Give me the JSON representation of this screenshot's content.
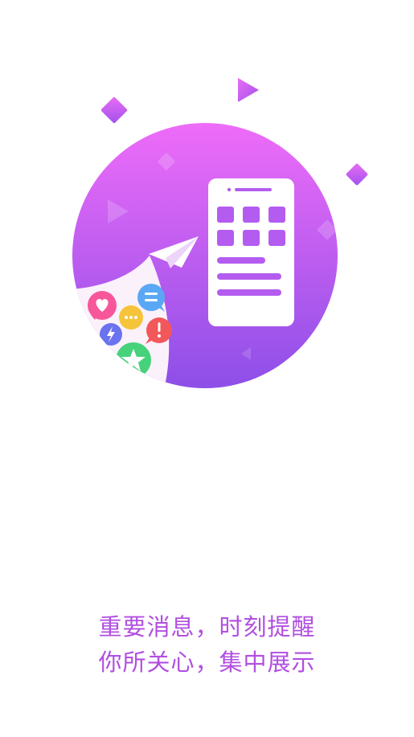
{
  "onboarding": {
    "caption": {
      "line1": "重要消息，时刻提醒",
      "line2": "你所关心，集中展示"
    }
  },
  "illustration": {
    "icons": [
      "heart-bubble-icon",
      "menu-bubble-icon",
      "dots-bubble-icon",
      "lightning-bubble-icon",
      "exclamation-bubble-icon",
      "star-bubble-icon",
      "paper-plane-icon",
      "phone-app-icon"
    ]
  },
  "colors": {
    "caption_text": "#b14fe0",
    "circle_top": "#ee6cf8",
    "circle_bottom": "#8d4fe8",
    "accent_purple": "#b45cf0",
    "white": "#ffffff",
    "bubble_pink": "#f7579a",
    "bubble_blue": "#5aa8f5",
    "bubble_yellow": "#f6c43a",
    "bubble_indigo": "#6a72ee",
    "bubble_red": "#f2575a",
    "bubble_green": "#46d27b"
  }
}
